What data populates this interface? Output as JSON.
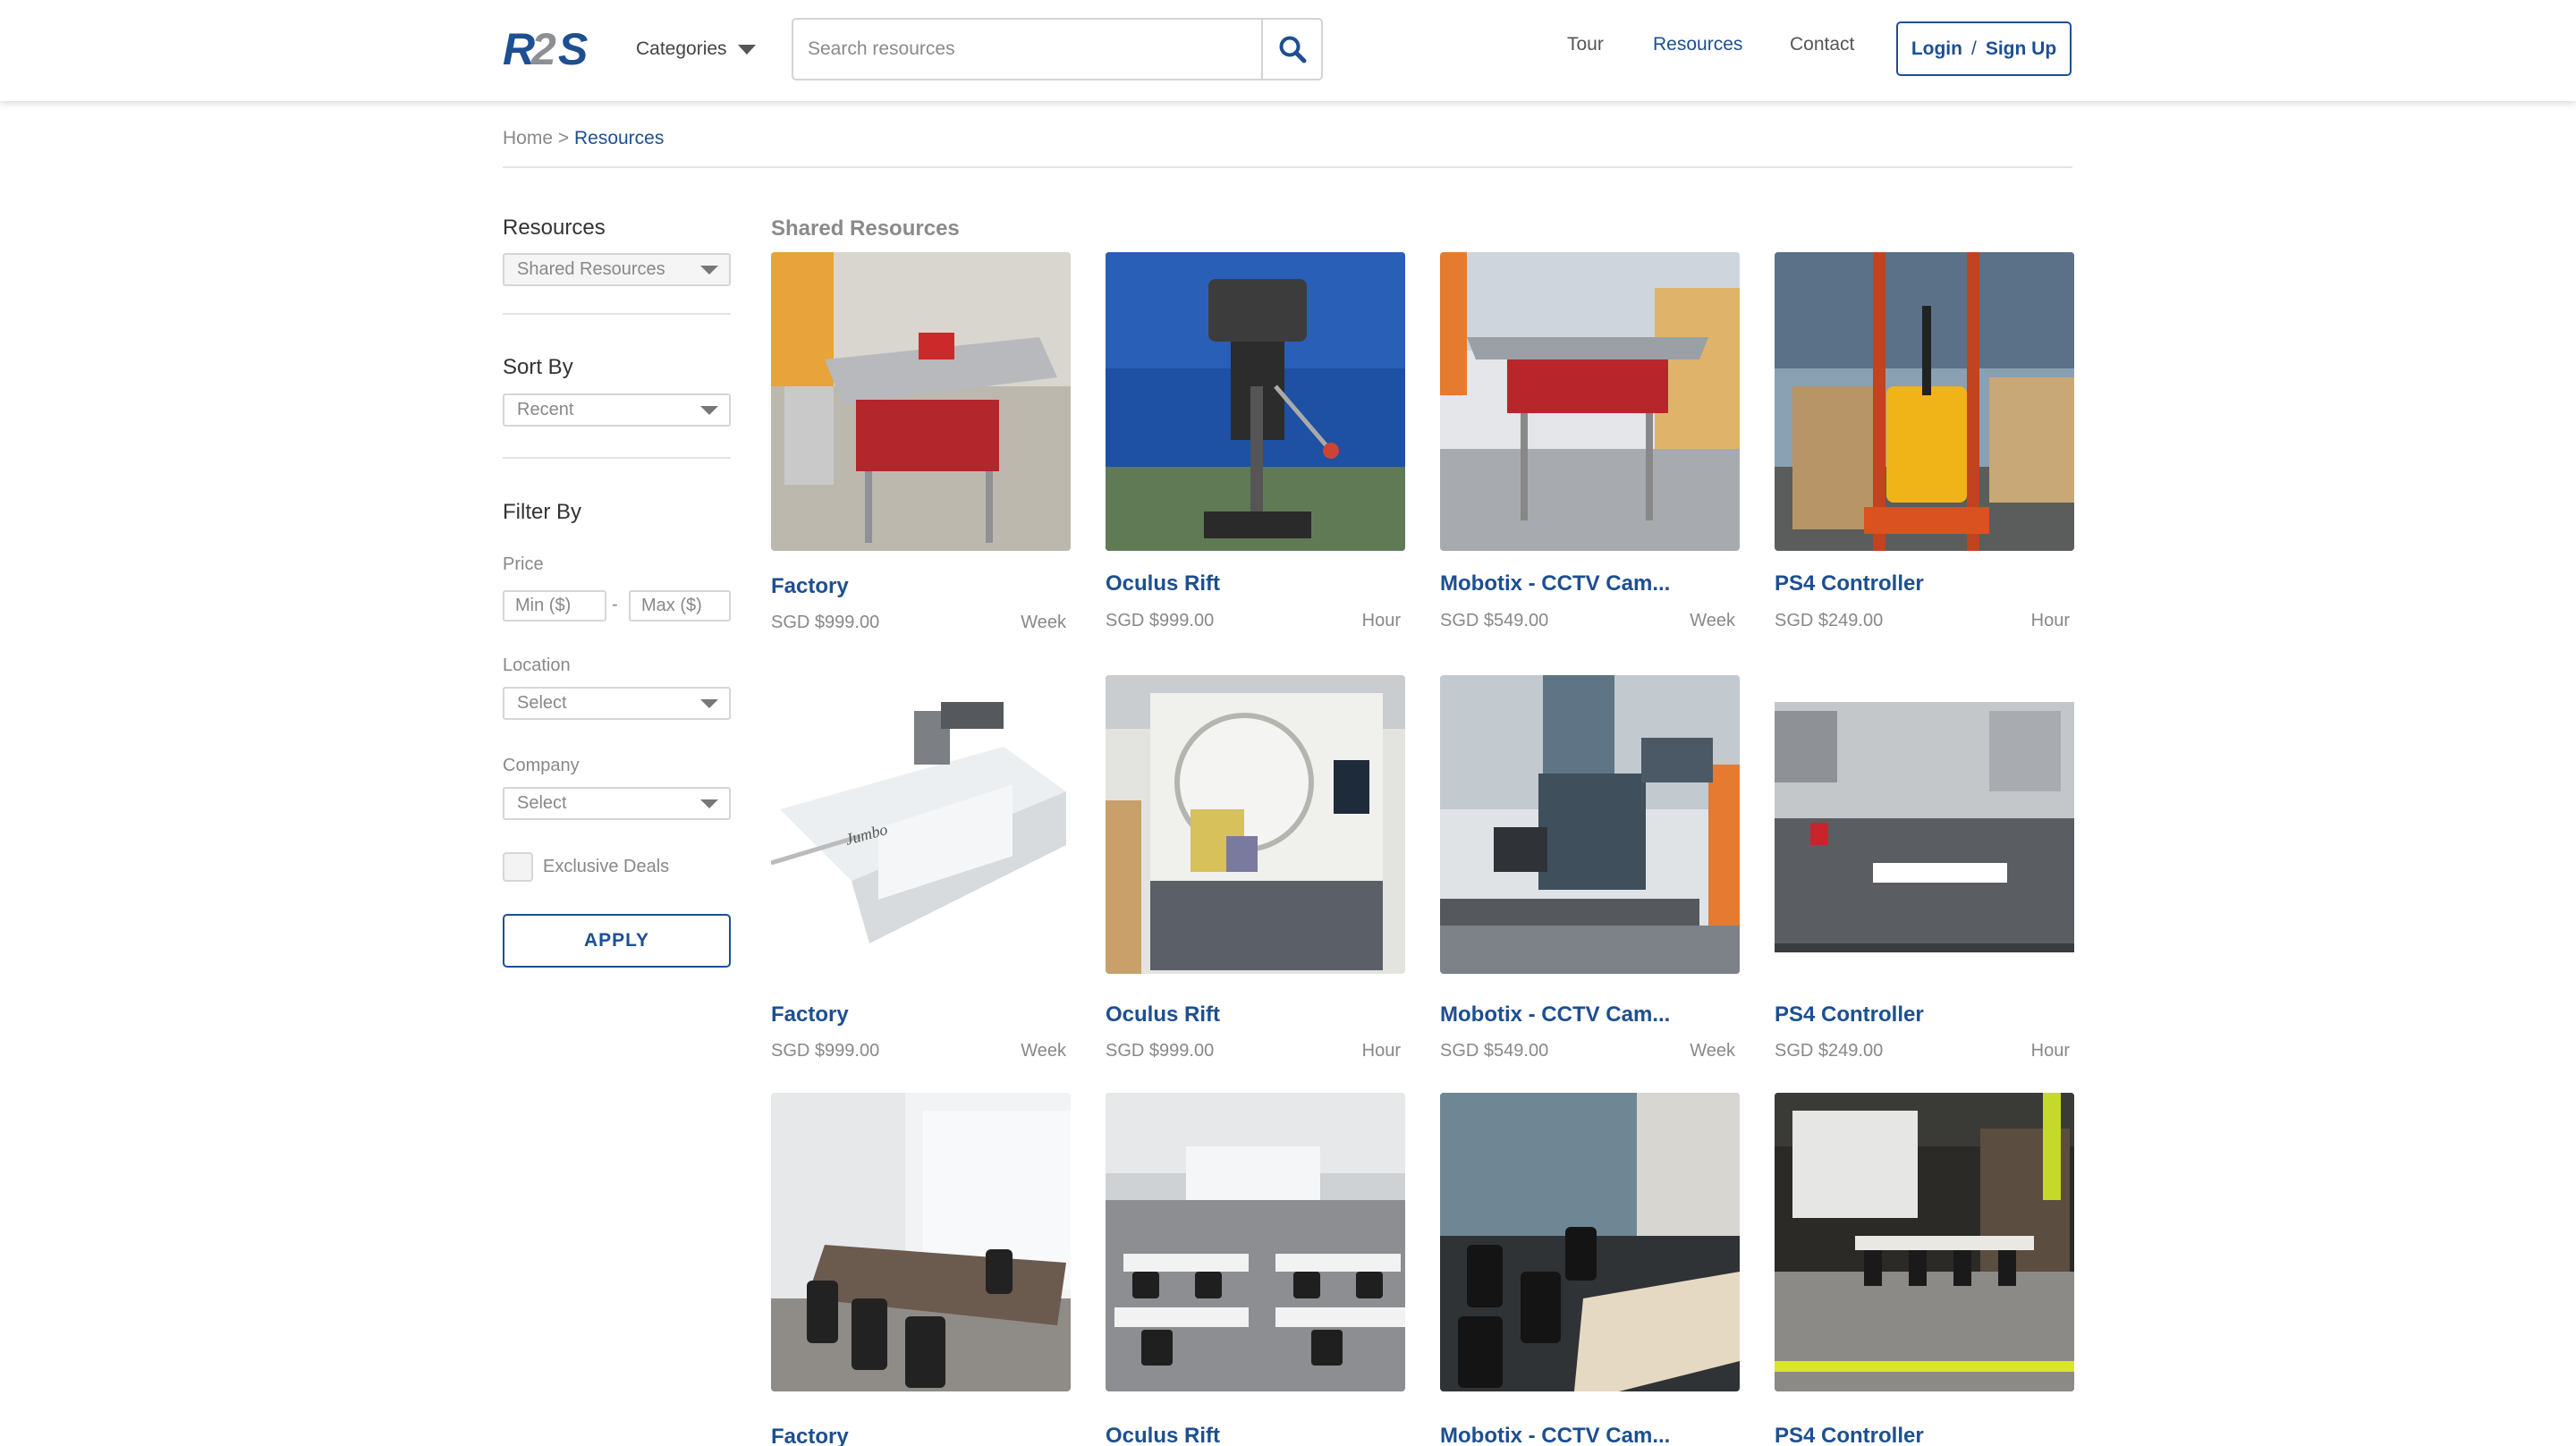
{
  "header": {
    "logo_text": "R2S",
    "categories_label": "Categories",
    "search": {
      "placeholder": "Search resources",
      "value": ""
    },
    "nav": {
      "tour": "Tour",
      "resources": "Resources",
      "contact": "Contact"
    },
    "login": {
      "login_label": "Login",
      "separator": "/",
      "signup_label": "Sign Up"
    }
  },
  "breadcrumb": {
    "home": "Home",
    "separator": " > ",
    "current": "Resources"
  },
  "sidebar": {
    "resources_title": "Resources",
    "resources_select": "Shared Resources",
    "sort_title": "Sort By",
    "sort_select": "Recent",
    "filter_title": "Filter By",
    "price_label": "Price",
    "min_placeholder": "Min ($)",
    "max_placeholder": "Max ($)",
    "price_dash": "-",
    "location_label": "Location",
    "location_select": "Select",
    "company_label": "Company",
    "company_select": "Select",
    "exclusive_label": "Exclusive Deals",
    "apply_label": "APPLY"
  },
  "section_title": "Shared Resources",
  "cards": [
    {
      "title": "Factory",
      "price": "SGD $999.00",
      "unit": "Week",
      "scene": "table-saw"
    },
    {
      "title": "Oculus Rift",
      "price": "SGD $999.00",
      "unit": "Hour",
      "scene": "drill-press"
    },
    {
      "title": "Mobotix - CCTV Cam...",
      "price": "SGD $549.00",
      "unit": "Week",
      "scene": "table-saw-2"
    },
    {
      "title": "PS4 Controller",
      "price": "SGD $249.00",
      "unit": "Hour",
      "scene": "pallet-jack"
    },
    {
      "title": "Factory",
      "price": "SGD $999.00",
      "unit": "Week",
      "scene": "panel-saw"
    },
    {
      "title": "Oculus Rift",
      "price": "SGD $999.00",
      "unit": "Hour",
      "scene": "cnc-machine"
    },
    {
      "title": "Mobotix - CCTV Cam...",
      "price": "SGD $549.00",
      "unit": "Week",
      "scene": "milling-machine"
    },
    {
      "title": "PS4 Controller",
      "price": "SGD $249.00",
      "unit": "Hour",
      "scene": "lathe"
    },
    {
      "title": "Factory",
      "price": "",
      "unit": "",
      "scene": "meeting-room"
    },
    {
      "title": "Oculus Rift",
      "price": "",
      "unit": "",
      "scene": "classroom"
    },
    {
      "title": "Mobotix - CCTV Cam...",
      "price": "",
      "unit": "",
      "scene": "office"
    },
    {
      "title": "PS4 Controller",
      "price": "",
      "unit": "",
      "scene": "event-space"
    }
  ],
  "colors": {
    "brand_blue": "#1d4f91",
    "logo_gray": "#8c8f94",
    "muted_text": "#888888"
  }
}
